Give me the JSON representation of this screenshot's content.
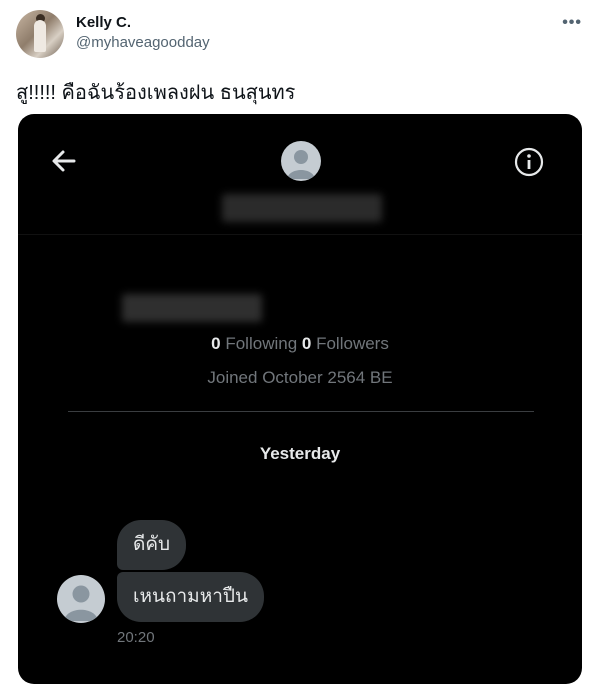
{
  "tweet": {
    "author_name": "Kelly C.",
    "author_handle": "@myhaveagoodday",
    "more_icon": "•••",
    "text": "สู!!!!! คือฉันร้องเพลงฝน ธนสุนทร"
  },
  "dm": {
    "profile": {
      "following_count": "0",
      "following_label": "Following",
      "followers_count": "0",
      "followers_label": "Followers",
      "joined": "Joined October 2564 BE"
    },
    "date_divider": "Yesterday",
    "messages": [
      {
        "text": "ดีคับ"
      },
      {
        "text": "เหนถามหาปืน"
      }
    ],
    "timestamp": "20:20",
    "icons": {
      "back": "back-arrow-icon",
      "info": "info-icon",
      "avatar": "default-avatar-icon"
    },
    "colors": {
      "background": "#000000",
      "bubble": "#2f3336",
      "text_primary": "#e7e9ea",
      "text_secondary": "#71767b"
    }
  }
}
